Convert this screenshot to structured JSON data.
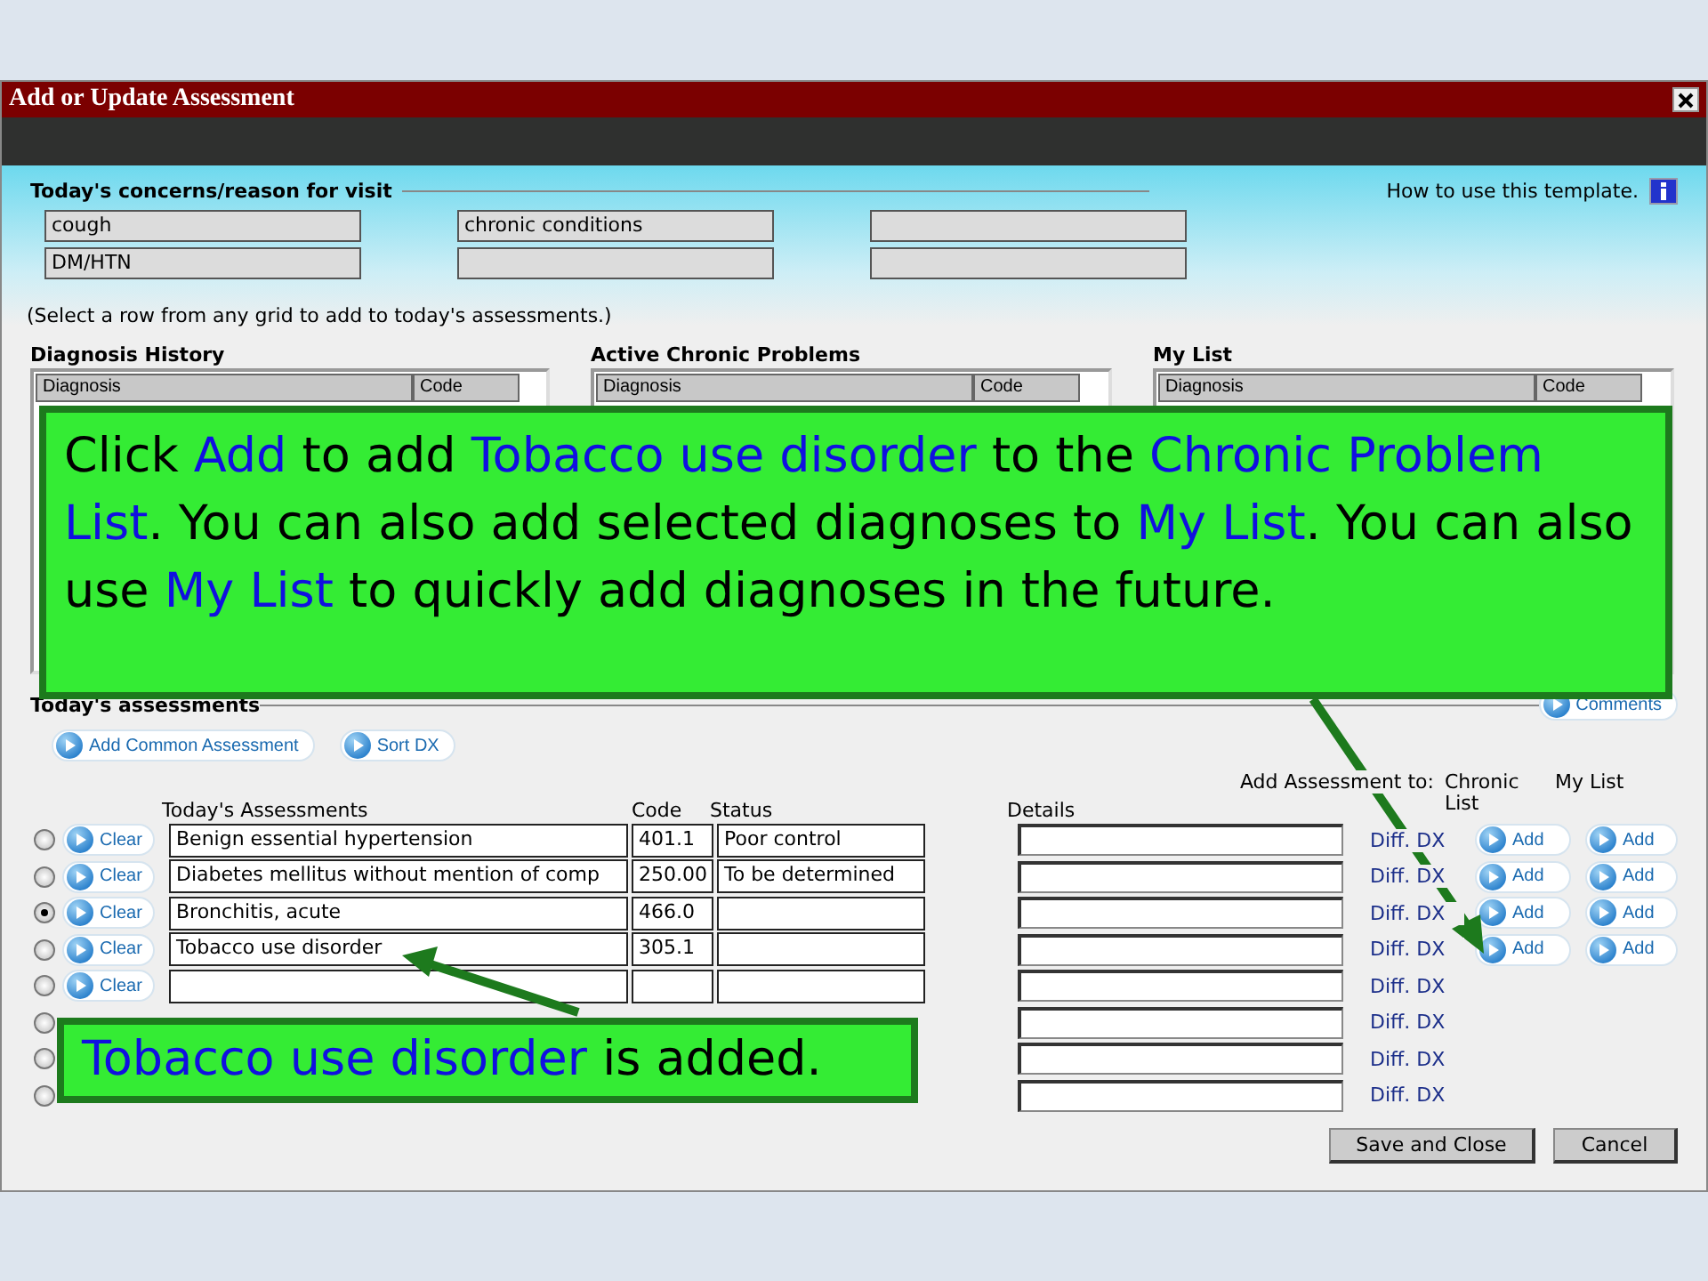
{
  "window": {
    "title": "Add or Update Assessment"
  },
  "concerns": {
    "title": "Today's concerns/reason for visit",
    "help": "How to use this template.",
    "fields": [
      [
        "cough",
        "chronic conditions"
      ],
      [
        "DM/HTN"
      ]
    ]
  },
  "instruction": "(Select a row from any grid to add to today's assessments.)",
  "grids": [
    {
      "title": "Diagnosis History",
      "columns": [
        "Diagnosis",
        "Code"
      ]
    },
    {
      "title": "Active Chronic Problems",
      "columns": [
        "Diagnosis",
        "Code"
      ]
    },
    {
      "title": "My List",
      "columns": [
        "Diagnosis",
        "Code"
      ]
    }
  ],
  "assessments": {
    "title": "Today's assessments",
    "comments": "Comments",
    "actions": [
      "Add Common Assessment",
      "Sort DX"
    ],
    "columns": {
      "assessment": "Today's Assessments",
      "code": "Code",
      "status": "Status",
      "details": "Details",
      "add_to": "Add Assessment to:",
      "chronic": "Chronic List",
      "my_list": "My List"
    },
    "rows": [
      {
        "selected": false,
        "clear": "Clear",
        "assessment": "Benign essential hypertension",
        "code": "401.1",
        "status": "Poor control",
        "diff": "Diff. DX",
        "chronic_add": "Add",
        "my_list_add": "Add"
      },
      {
        "selected": false,
        "clear": "Clear",
        "assessment": "Diabetes mellitus without mention of comp",
        "code": "250.00",
        "status": "To be determined",
        "diff": "Diff. DX",
        "chronic_add": "Add",
        "my_list_add": "Add"
      },
      {
        "selected": true,
        "clear": "Clear",
        "assessment": "Bronchitis, acute",
        "code": "466.0",
        "diff": "Diff. DX",
        "chronic_add": "Add",
        "my_list_add": "Add"
      },
      {
        "selected": false,
        "clear": "Clear",
        "assessment": "Tobacco use disorder",
        "code": "305.1",
        "diff": "Diff. DX",
        "chronic_add": "Add",
        "my_list_add": "Add"
      },
      {
        "selected": false,
        "clear": "Clear",
        "diff": "Diff. DX"
      },
      {
        "selected": false,
        "diff": "Diff. DX"
      },
      {
        "selected": false,
        "diff": "Diff. DX"
      },
      {
        "selected": false,
        "diff": "Diff. DX"
      }
    ]
  },
  "buttons": [
    "Save and Close",
    "Cancel"
  ],
  "callouts": [
    {
      "kind": "note",
      "segments": [
        {
          "text": "Click ",
          "highlight": false
        },
        {
          "text": "Add",
          "highlight": true
        },
        {
          "text": " to add ",
          "highlight": false
        },
        {
          "text": "Tobacco use disorder",
          "highlight": true
        },
        {
          "text": " to the ",
          "highlight": false
        },
        {
          "text": "Chronic Problem List",
          "highlight": true
        },
        {
          "text": ".  You can also add selected diagnoses to ",
          "highlight": false
        },
        {
          "text": "My List",
          "highlight": true
        },
        {
          "text": ".  You can also use ",
          "highlight": false
        },
        {
          "text": "My List",
          "highlight": true
        },
        {
          "text": " to quickly add diagnoses in the future.",
          "highlight": false
        }
      ]
    },
    {
      "kind": "result",
      "segments": [
        {
          "text": "Tobacco use disorder",
          "highlight": true
        },
        {
          "text": " is added.",
          "highlight": false
        }
      ]
    }
  ]
}
